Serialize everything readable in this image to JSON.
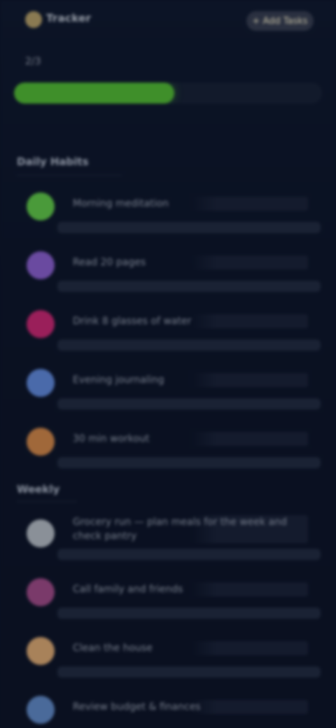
{
  "header": {
    "title": "Tracker",
    "action_label": "+ Add Tasks"
  },
  "progress": {
    "label": "2/3",
    "fraction": 0.52,
    "fill_color": "#3f8f2a"
  },
  "sections": [
    {
      "title": "Daily Habits",
      "items": [
        {
          "label": "Morning meditation",
          "icon_color": "#4a9a3a",
          "icon": "leaf-icon"
        },
        {
          "label": "Read 20 pages",
          "icon_color": "#6a4aa0",
          "icon": "book-icon"
        },
        {
          "label": "Drink 8 glasses of water",
          "icon_color": "#9a1f5a",
          "icon": "drop-icon"
        },
        {
          "label": "Evening journaling",
          "icon_color": "#4a6aaa",
          "icon": "pen-icon"
        },
        {
          "label": "30 min workout",
          "icon_color": "#a0683a",
          "icon": "dumbbell-icon"
        }
      ]
    },
    {
      "title": "Weekly",
      "items": [
        {
          "label": "Grocery run — plan meals for the week and check pantry",
          "icon_color": "#8a9098",
          "icon": "cart-icon"
        },
        {
          "label": "Call family and friends",
          "icon_color": "#7a3a6a",
          "icon": "phone-icon"
        },
        {
          "label": "Clean the house",
          "icon_color": "#a8825a",
          "icon": "broom-icon"
        },
        {
          "label": "Review budget & finances",
          "icon_color": "#4a6a9a",
          "icon": "wallet-icon"
        }
      ]
    }
  ]
}
